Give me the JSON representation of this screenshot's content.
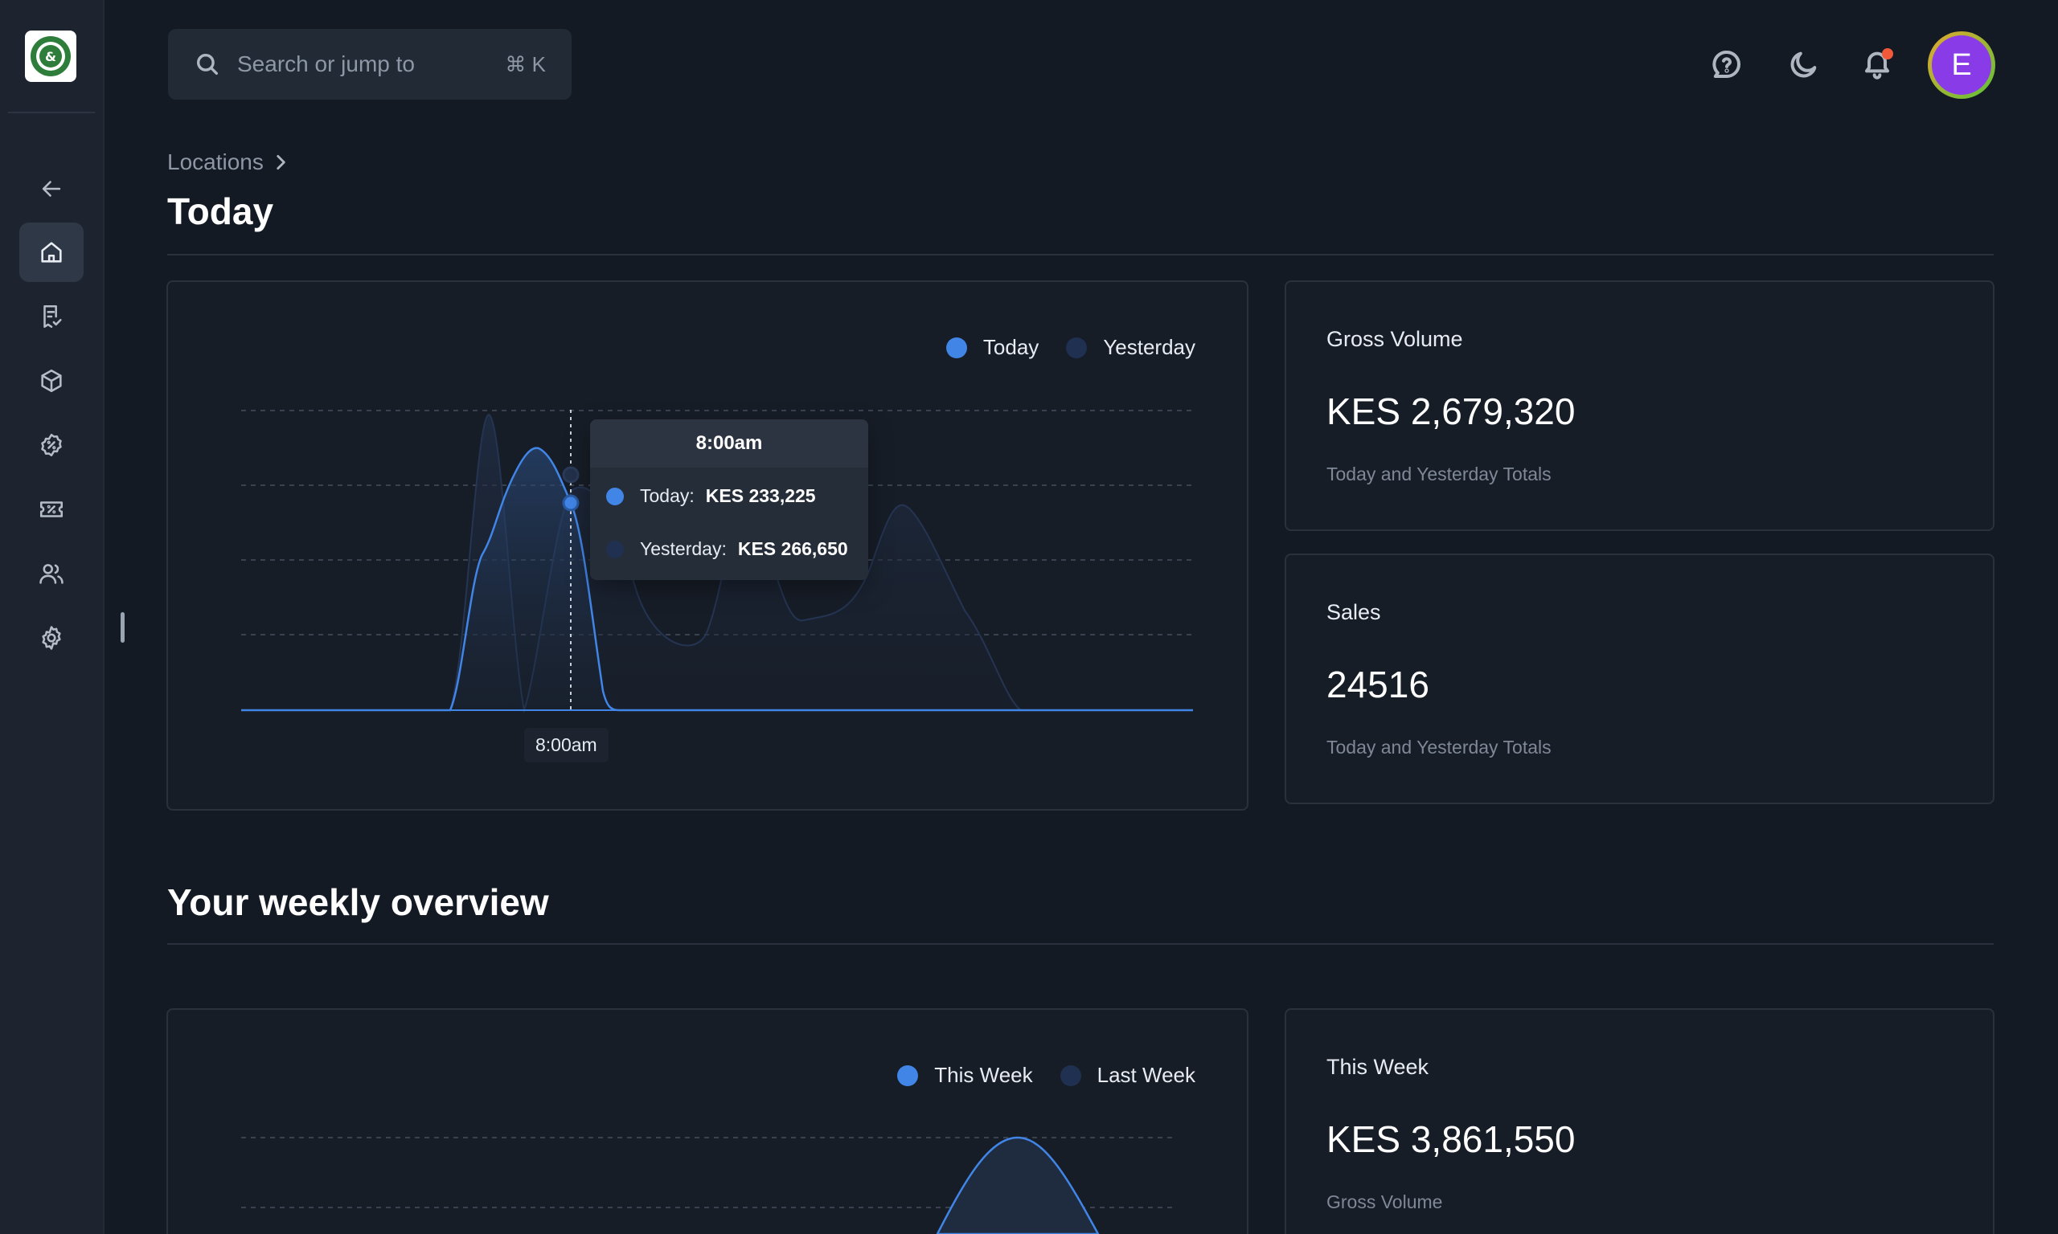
{
  "search": {
    "placeholder": "Search or jump to",
    "shortcut": "⌘ K"
  },
  "breadcrumb": {
    "items": [
      "Locations"
    ]
  },
  "page_title": "Today",
  "today_chart": {
    "legend": [
      {
        "label": "Today",
        "color": "#4185e6"
      },
      {
        "label": "Yesterday",
        "color": "#1f3050"
      }
    ],
    "tooltip": {
      "time": "8:00am",
      "today_label": "Today:",
      "today_value": "KES 233,225",
      "yesterday_label": "Yesterday:",
      "yesterday_value": "KES 266,650"
    },
    "x_tip": "8:00am"
  },
  "gross_volume": {
    "label": "Gross Volume",
    "value": "KES 2,679,320",
    "sub": "Today and Yesterday Totals"
  },
  "sales": {
    "label": "Sales",
    "value": "24516",
    "sub": "Today and Yesterday Totals"
  },
  "weekly": {
    "title": "Your weekly overview",
    "legend": [
      {
        "label": "This Week",
        "color": "#4185e6"
      },
      {
        "label": "Last Week",
        "color": "#1f3050"
      }
    ],
    "this_week": {
      "label": "This Week",
      "value": "KES 3,861,550",
      "sub": "Gross Volume"
    }
  },
  "user": {
    "initial": "E"
  },
  "icons": {
    "sidebar": [
      "arrow-left-icon",
      "home-icon",
      "receipt-icon",
      "box-icon",
      "discount-icon",
      "ticket-icon",
      "users-icon",
      "gear-icon"
    ],
    "top": [
      "help-icon",
      "moon-icon",
      "bell-icon"
    ]
  },
  "chart_data": [
    {
      "type": "area",
      "legend_placement": "top-right",
      "grid": true,
      "series": [
        {
          "name": "Today"
        },
        {
          "name": "Yesterday"
        }
      ],
      "highlight": {
        "x": "8:00am",
        "Today": 233225,
        "Yesterday": 266650
      }
    },
    {
      "type": "area",
      "legend_placement": "top-right",
      "grid": true,
      "series": [
        {
          "name": "This Week"
        },
        {
          "name": "Last Week"
        }
      ]
    }
  ]
}
